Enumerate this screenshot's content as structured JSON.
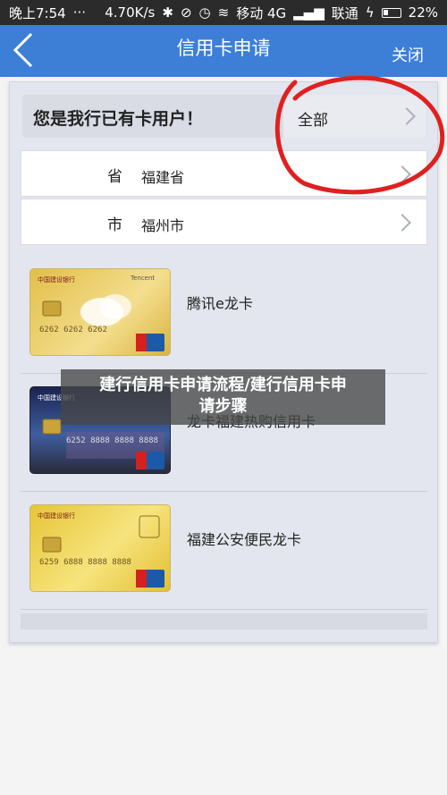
{
  "status_bar": {
    "time": "晚上7:54",
    "dots": "···",
    "speed": "4.70K/s",
    "carrier1": "移动 4G",
    "carrier2": "联通",
    "battery": "22%"
  },
  "nav": {
    "title": "信用卡申请",
    "close": "关闭",
    "back_icon": "chevron-left-icon"
  },
  "form": {
    "question": "您是我行已有卡用户！",
    "user_type": "全部",
    "province_label": "省",
    "province_value": "福建省",
    "city_label": "市",
    "city_value": "福州市"
  },
  "cards": [
    {
      "name": "腾讯e龙卡",
      "card_number": "6262 6262 6262",
      "brand": "Tencent",
      "bank": "中国建设银行",
      "colors": {
        "bg1": "#e6c757",
        "bg2": "#f3dd84"
      }
    },
    {
      "name": "龙卡福建热购信用卡",
      "card_number": "6252 8888 8888 8888",
      "brand": "",
      "bank": "中国建设银行",
      "colors": {
        "bg1": "#1c2c5c",
        "bg2": "#3c5a9a"
      }
    },
    {
      "name": "福建公安便民龙卡",
      "card_number": "6259 6888 8888 8888",
      "brand": "",
      "bank": "中国建设银行",
      "colors": {
        "bg1": "#e8c93c",
        "bg2": "#f6e27a"
      }
    }
  ],
  "overlay": {
    "line1": "建行信用卡申请流程/建行信用卡申",
    "line2": "请步骤"
  },
  "colors": {
    "nav": "#3d7fd7",
    "annotation": "#e02020"
  }
}
